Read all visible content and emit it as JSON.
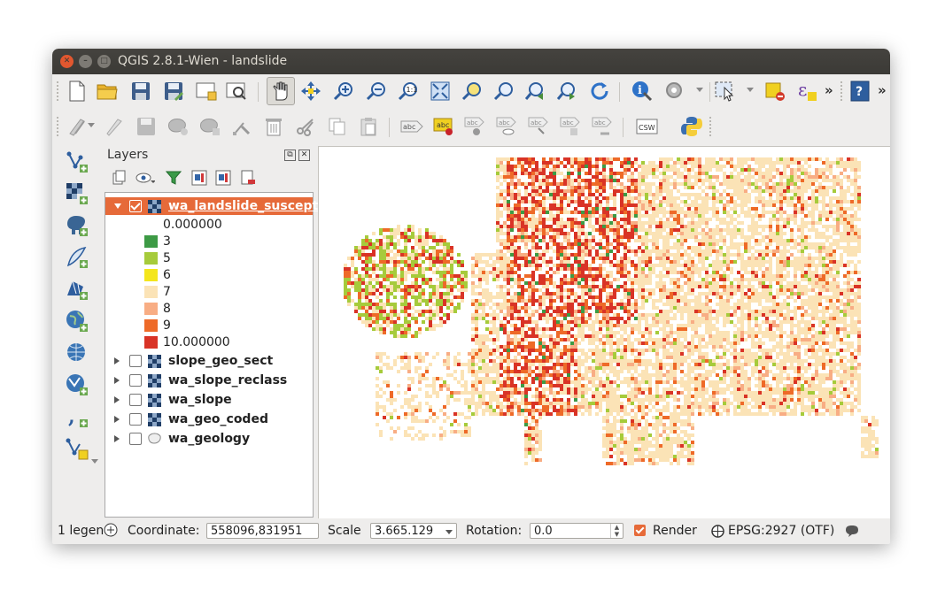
{
  "window": {
    "title": "QGIS 2.8.1-Wien - landslide"
  },
  "toolbars": {
    "row1_icons": [
      "new-project-icon",
      "open-project-icon",
      "save-project-icon",
      "save-as-icon",
      "new-print-composer-icon",
      "composer-manager-icon",
      "pan-map-icon",
      "pan-to-selection-icon",
      "zoom-in-icon",
      "zoom-out-icon",
      "zoom-native-icon",
      "zoom-full-icon",
      "zoom-to-selection-icon",
      "zoom-to-layer-icon",
      "zoom-last-icon",
      "zoom-next-icon",
      "refresh-icon",
      "identify-icon",
      "map-tips-icon",
      "select-features-icon",
      "deselect-icon",
      "expression-select-icon",
      "help-icon"
    ],
    "row2_icons": [
      "digitize-icon",
      "edit-pencil-icon",
      "save-edits-icon",
      "add-feature-icon",
      "move-feature-icon",
      "node-tool-icon",
      "delete-selected-icon",
      "cut-features-icon",
      "copy-features-icon",
      "paste-features-icon",
      "label-icon",
      "layer-labeling-icon",
      "pin-labels-icon",
      "show-hide-labels-icon",
      "move-label-icon",
      "rotate-label-icon",
      "change-label-icon",
      "csw-icon",
      "python-icon"
    ],
    "overflow_label": "»",
    "csw_label": "CSW",
    "abc_label": "abc",
    "expression_symbol": "ε"
  },
  "left_toolbar": {
    "icons": [
      "add-vector-layer-icon",
      "add-raster-layer-icon",
      "add-postgis-layer-icon",
      "add-spatialite-layer-icon",
      "add-mssql-layer-icon",
      "add-wms-layer-icon",
      "add-wcs-layer-icon",
      "add-wfs-layer-icon",
      "add-delimited-text-icon",
      "new-shapefile-icon"
    ]
  },
  "layers_panel": {
    "title": "Layers",
    "toolbar_icons": [
      "add-group-icon",
      "manage-visibility-icon",
      "filter-legend-icon",
      "expand-all-icon",
      "collapse-all-icon",
      "remove-layer-icon"
    ],
    "layers": [
      {
        "name": "wa_landslide_suscept",
        "checked": true,
        "expanded": true,
        "selected": true,
        "type": "raster",
        "legend": [
          {
            "label": "0.000000",
            "color": ""
          },
          {
            "label": "3",
            "color": "#3d9a45"
          },
          {
            "label": "5",
            "color": "#a6cb3b"
          },
          {
            "label": "6",
            "color": "#f4e61c"
          },
          {
            "label": "7",
            "color": "#fbe3b6"
          },
          {
            "label": "8",
            "color": "#f8ad84"
          },
          {
            "label": "9",
            "color": "#ee6a28"
          },
          {
            "label": "10.000000",
            "color": "#d93326"
          }
        ]
      },
      {
        "name": "slope_geo_sect",
        "checked": false,
        "expanded": false,
        "type": "raster"
      },
      {
        "name": "wa_slope_reclass",
        "checked": false,
        "expanded": false,
        "type": "raster"
      },
      {
        "name": "wa_slope",
        "checked": false,
        "expanded": false,
        "type": "raster"
      },
      {
        "name": "wa_geo_coded",
        "checked": false,
        "expanded": false,
        "type": "raster"
      },
      {
        "name": "wa_geology",
        "checked": false,
        "expanded": false,
        "type": "vector"
      }
    ]
  },
  "map": {
    "palette": [
      "#fbe3b6",
      "#f8ad84",
      "#ee6a28",
      "#d93326",
      "#a6cb3b",
      "#3d9a45"
    ]
  },
  "statusbar": {
    "legend_count": "1 legen",
    "coordinate_label": "Coordinate:",
    "coordinate_value": "558096,831951",
    "scale_label": "Scale",
    "scale_value": "3.665.129",
    "rotation_label": "Rotation:",
    "rotation_value": "0.0",
    "render_label": "Render",
    "render_checked": true,
    "crs_label": "EPSG:2927 (OTF)"
  },
  "colors": {
    "accent": "#e66a39",
    "titlebar": "#3b3a36",
    "window_bg": "#eeedec"
  }
}
